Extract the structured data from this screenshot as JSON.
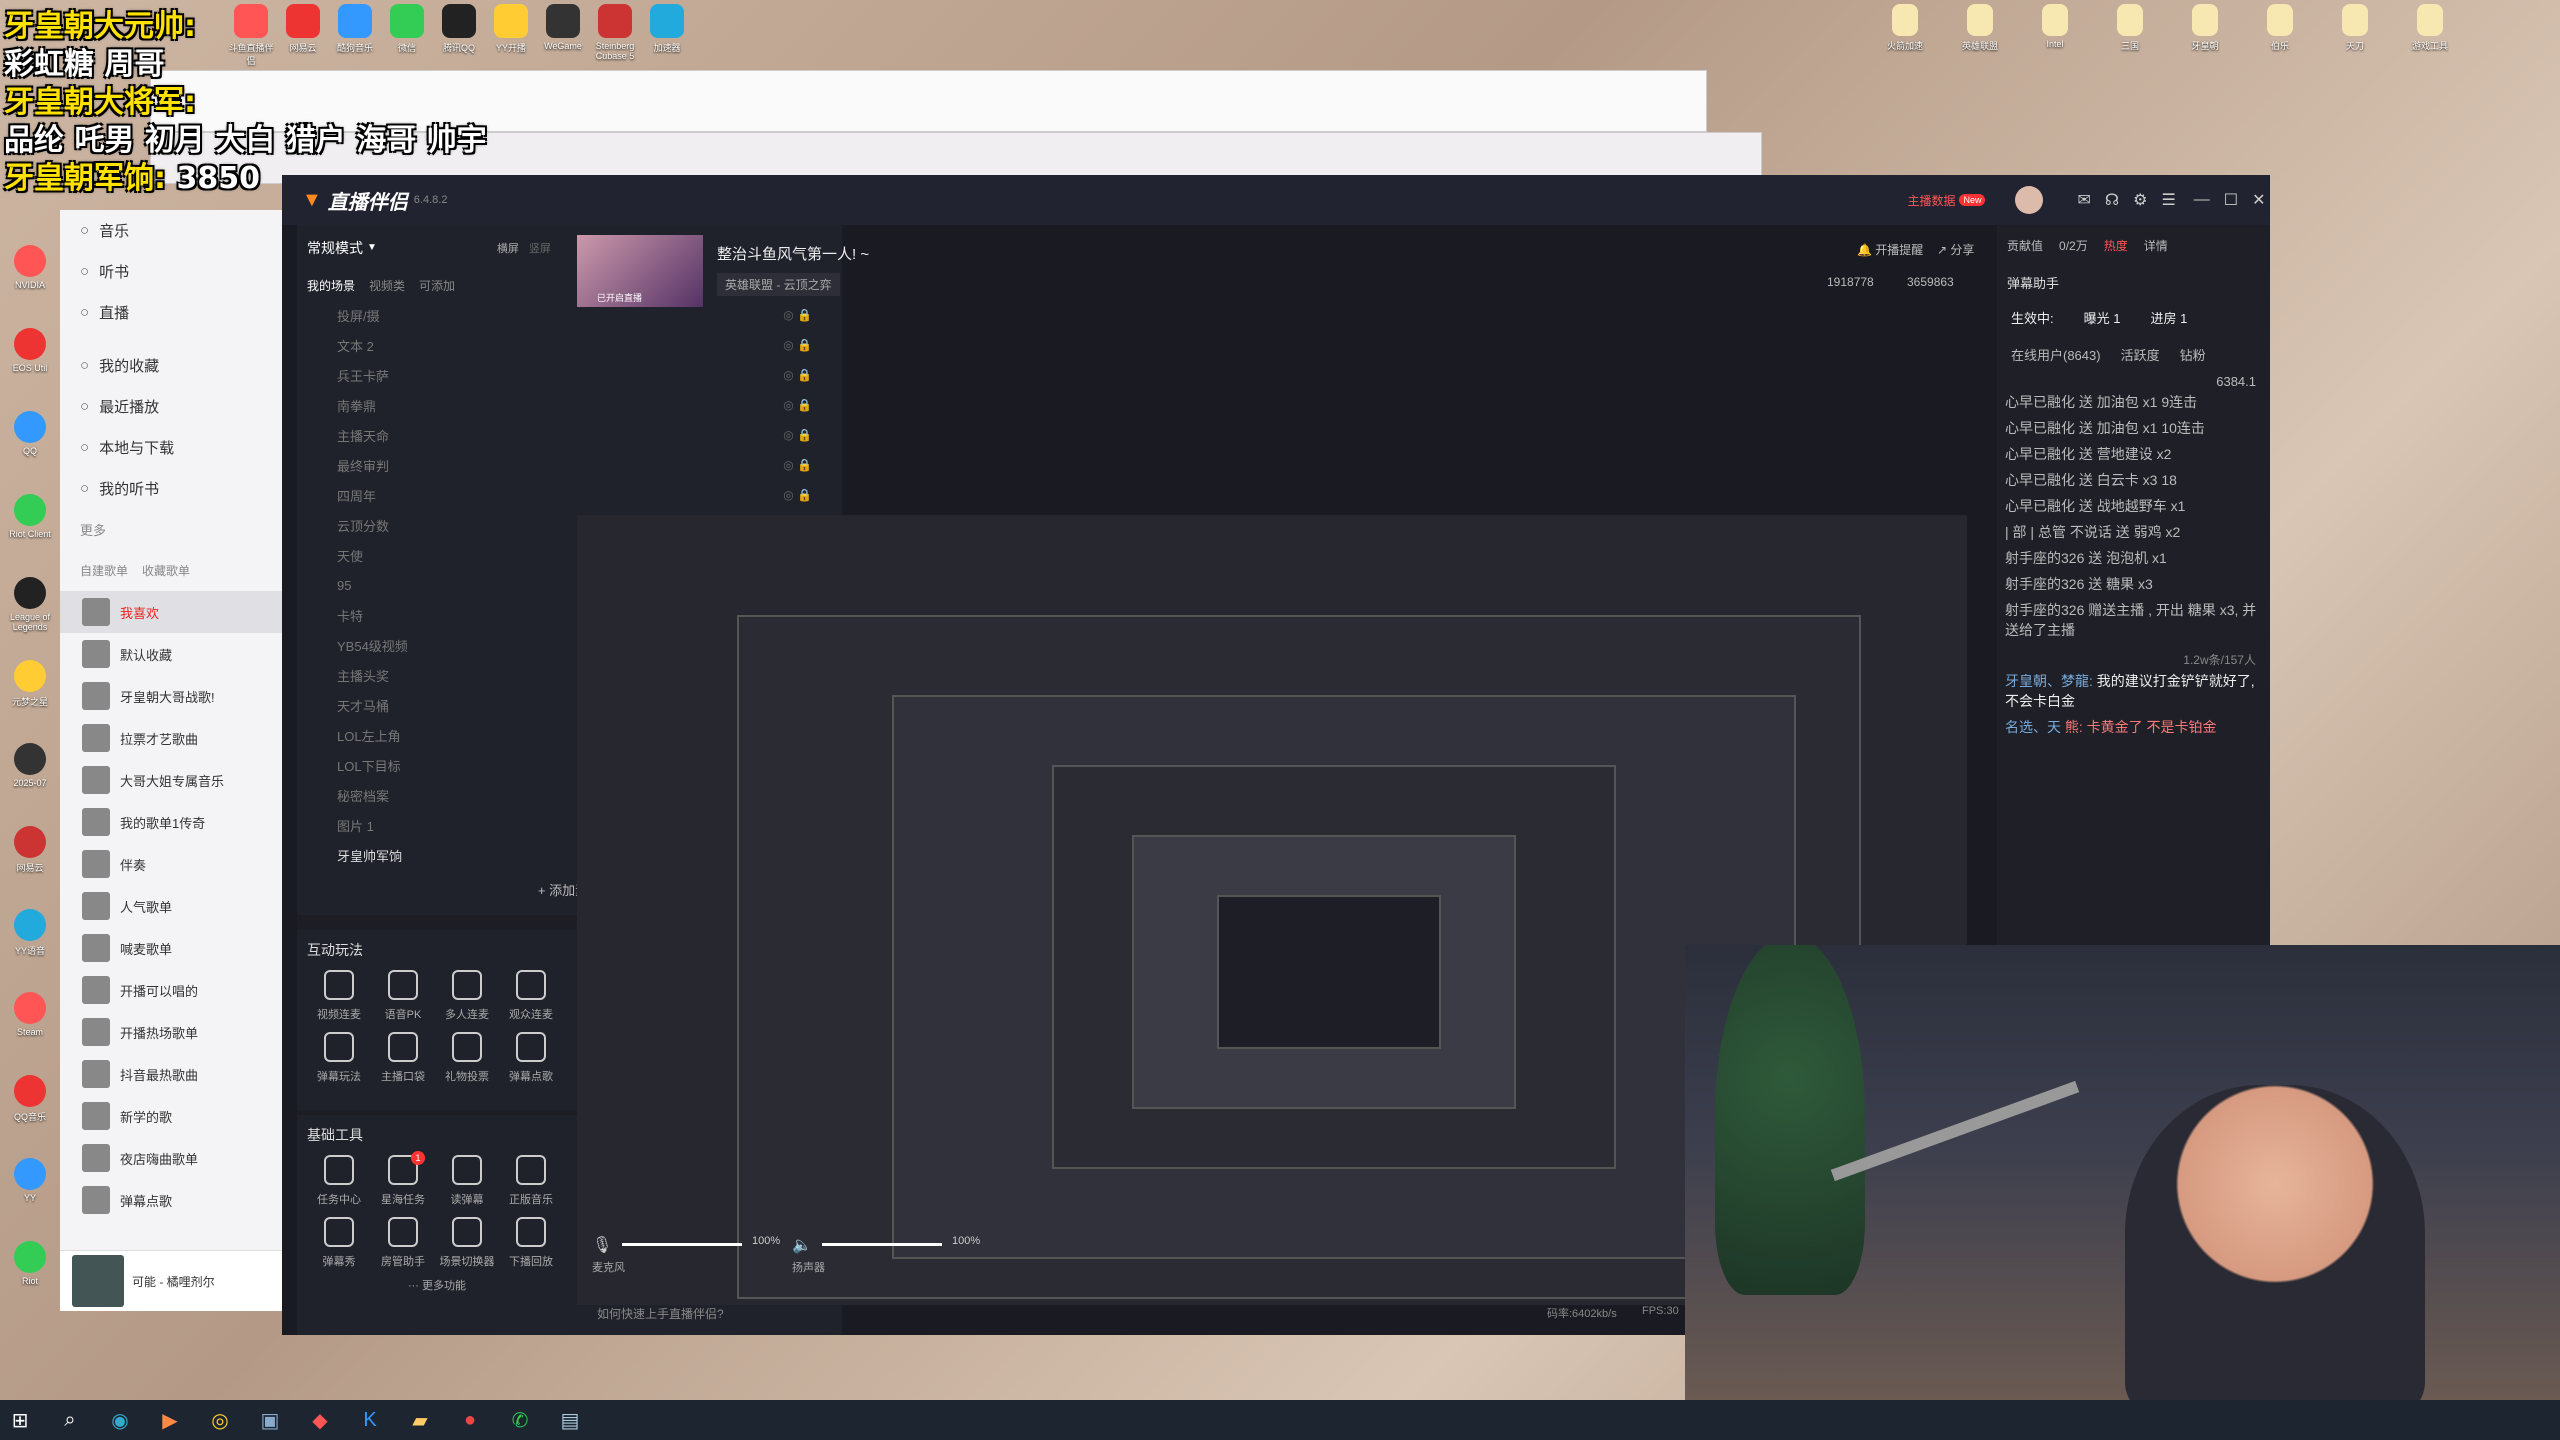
{
  "overlay": {
    "lines": [
      {
        "label": "牙皇朝大元帅:"
      },
      {
        "value": "彩虹糖  周哥"
      },
      {
        "label": "牙皇朝大将军:"
      },
      {
        "value": "品纶 吒男 初月 大白 猎户 海哥 帅宇"
      },
      {
        "label": "牙皇朝军饷:",
        "amount": "3850"
      }
    ]
  },
  "desktop_icons_top": [
    "斗鱼直播伴侣",
    "网易云",
    "酷狗音乐",
    "微信",
    "腾讯QQ",
    "YY开播",
    "WeGame",
    "Steinberg Cubase 5",
    "加速器"
  ],
  "desktop_icons_top_right": [
    "火箭加速",
    "英雄联盟",
    "Intel",
    "三国",
    "牙皇朝",
    "伯乐",
    "天刀",
    "游戏工具"
  ],
  "desktop_icons_left": [
    "NVIDIA",
    "EOS Util",
    "QQ",
    "Riot Client",
    "League of Legends",
    "元梦之星",
    "2025-07",
    "网易云",
    "YY语音",
    "Steam",
    "QQ音乐",
    "YY",
    "Riot"
  ],
  "music": {
    "nav": [
      "音乐",
      "听书",
      "直播"
    ],
    "nav2": [
      "我的收藏",
      "最近播放",
      "本地与下载",
      "我的听书"
    ],
    "more": "更多",
    "tabs": [
      "自建歌单",
      "收藏歌单"
    ],
    "playlists": [
      "我喜欢",
      "默认收藏",
      "牙皇朝大哥战歌!",
      "拉票才艺歌曲",
      "大哥大姐专属音乐",
      "我的歌单1传奇",
      "伴奏",
      "人气歌单",
      "喊麦歌单",
      "开播可以唱的",
      "开播热场歌单",
      "抖音最热歌曲",
      "新学的歌",
      "夜店嗨曲歌单",
      "弹幕点歌"
    ],
    "now_playing": "可能 - 橘哩剂尔"
  },
  "stream": {
    "app_name": "直播伴侣",
    "version": "6.4.8.2",
    "badge_new": "New",
    "streamer_data": "主播数据",
    "mode": "常规模式",
    "mode_links": [
      "横屏",
      "竖屏"
    ],
    "scene_tabs": [
      "我的场景",
      "视频类",
      "可添加"
    ],
    "sources": [
      "投屏/摄",
      "文本 2",
      "兵王卡萨",
      "南拳鼎",
      "主播天命",
      "最终审判",
      "四周年",
      "云顶分数",
      "天使",
      "95",
      "卡特",
      "YB54级视频",
      "主播头奖",
      "天才马桶",
      "LOL左上角",
      "LOL下目标",
      "秘密档案",
      "图片 1",
      "牙皇帅军饷"
    ],
    "add_source": "添加素材",
    "interaction_title": "互动玩法",
    "interaction_tools": [
      "视频连麦",
      "语音PK",
      "多人连麦",
      "观众连麦",
      "弹幕玩法",
      "主播口袋",
      "礼物投票",
      "弹幕点歌"
    ],
    "basic_title": "基础工具",
    "basic_tools": [
      "任务中心",
      "星海任务",
      "读弹幕",
      "正版音乐",
      "弹幕秀",
      "房管助手",
      "场景切换器",
      "下播回放"
    ],
    "basic_badge": "1",
    "more_features": "更多功能",
    "room_title": "整治斗鱼风气第一人! ~",
    "room_tag": "英雄联盟 - 云顶之弈",
    "live_badge": "已开启直播",
    "open_remind": "开播提醒",
    "share": "分享",
    "followers": "1918778",
    "likes": "3659863",
    "mic_label": "麦克风",
    "mic_level": "100%",
    "speaker_label": "扬声器",
    "speaker_level": "100%",
    "help_text": "如何快速上手直播伴侣?",
    "bitrate": "码率:6402kb/s",
    "fps": "FPS:30"
  },
  "chat": {
    "contrib_label": "贡献值",
    "contrib_value": "0/2万",
    "hot_label": "热度",
    "detail_label": "详情",
    "assistant_title": "弹幕助手",
    "effect_label": "生效中:",
    "exposure": "曝光 1",
    "entry": "进房 1",
    "online_tabs": [
      "在线用户(8643)",
      "活跃度",
      "钻粉"
    ],
    "gift_total": "6384.1",
    "messages": [
      "心早已融化 送 加油包 x1 9连击",
      "心早已融化 送 加油包 x1 10连击",
      "心早已融化 送 营地建设 x2",
      "心早已融化 送 白云卡 x3 18",
      "心早已融化 送 战地越野车 x1",
      "| 部 | 总管 不说话 送 弱鸡 x2",
      "射手座的326 送 泡泡机 x1",
      "射手座的326 送 糖果 x3",
      "射手座的326 赠送主播 , 开出 糖果 x3, 并送给了主播"
    ],
    "viewer_count": "1.2w条/157人",
    "last_msg_user": "牙皇朝、梦龍:",
    "last_msg": "我的建议打金铲铲就好了, 不会卡白金",
    "last_msg2_user": "名选、天",
    "last_msg2": "熊: 卡黄金了 不是卡铂金"
  }
}
